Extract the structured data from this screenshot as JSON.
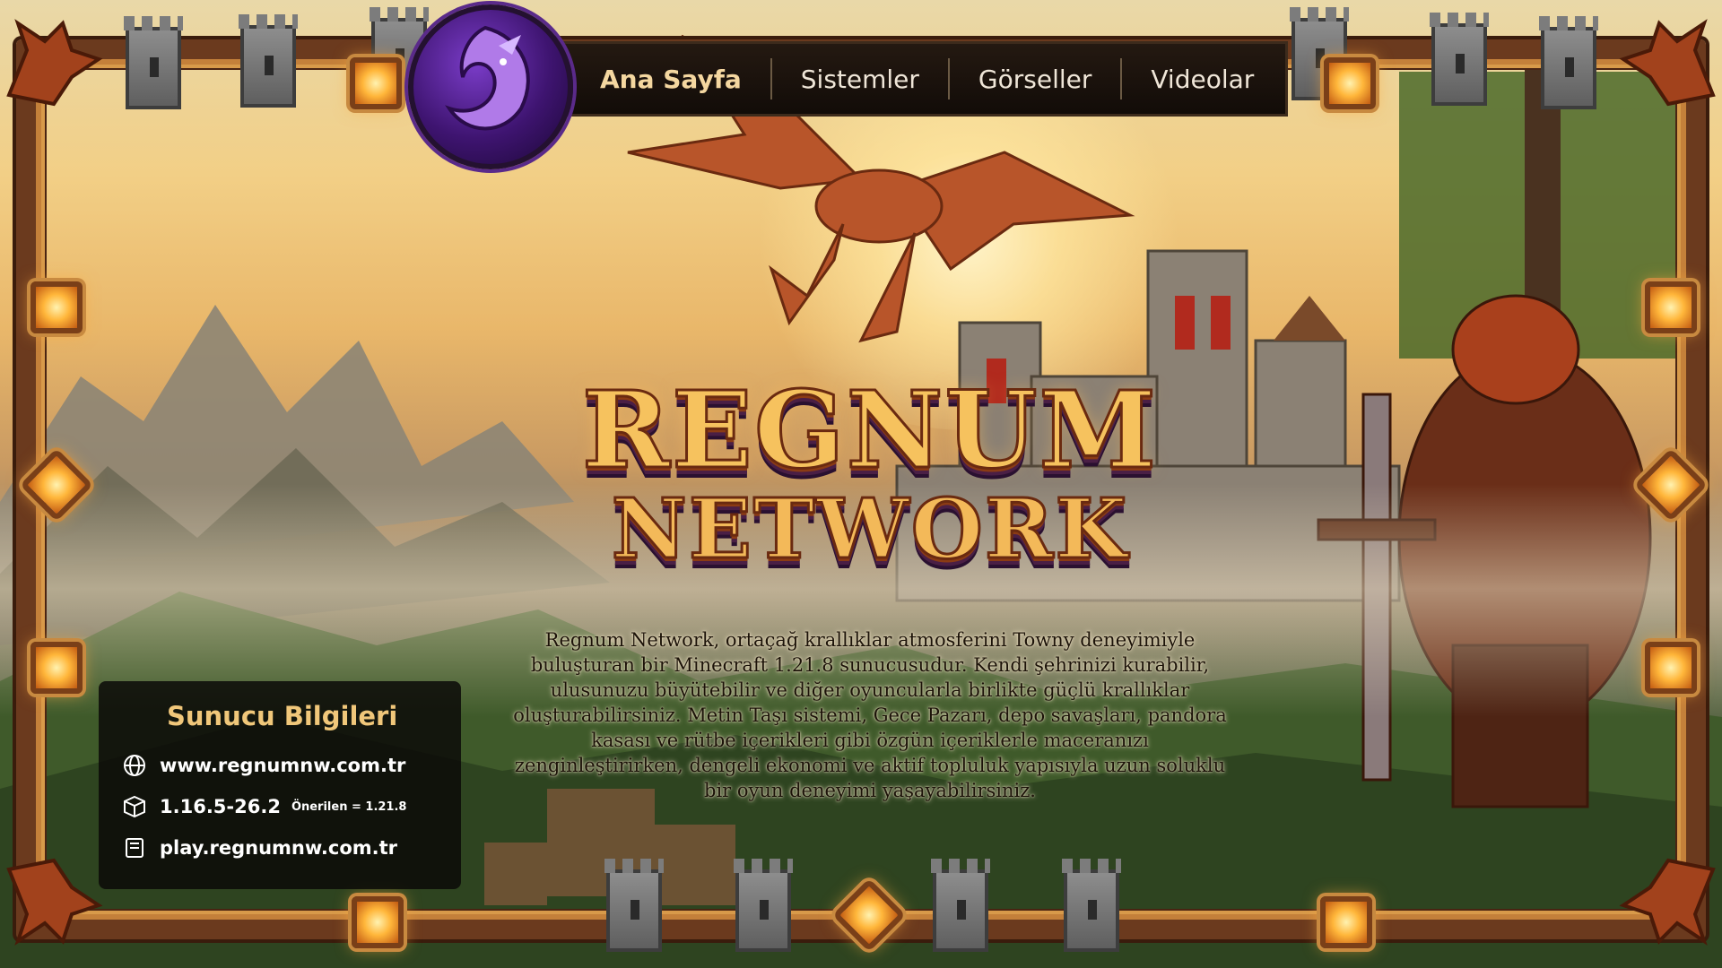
{
  "nav": {
    "items": [
      {
        "label": "Ana Sayfa",
        "active": true
      },
      {
        "label": "Sistemler",
        "active": false
      },
      {
        "label": "Görseller",
        "active": false
      },
      {
        "label": "Videolar",
        "active": false
      }
    ]
  },
  "hero": {
    "title_line1": "REGNUM",
    "title_line2": "NETWORK",
    "description": "Regnum Network, ortaçağ krallıklar atmosferini Towny deneyimiyle buluşturan bir Minecraft 1.21.8 sunucusudur. Kendi şehrinizi kurabilir, ulusunuzu büyütebilir ve diğer oyuncularla birlikte güçlü krallıklar oluşturabilirsiniz. Metin Taşı sistemi, Gece Pazarı, depo savaşları, pandora kasası ve rütbe içerikleri gibi özgün içeriklerle maceranızı zenginleştirirken, dengeli ekonomi ve aktif topluluk yapısıyla uzun soluklu bir oyun deneyimi yaşayabilirsiniz."
  },
  "server_info": {
    "title": "Sunucu Bilgileri",
    "website": "www.regnumnw.com.tr",
    "versions": "1.16.5-26.2",
    "recommended": "Önerilen = 1.21.8",
    "ip": "play.regnumnw.com.tr"
  },
  "icons": {
    "logo": "purple-dragon-logo",
    "website": "globe-icon",
    "version": "cube-icon",
    "ip": "book-icon"
  },
  "colors": {
    "frame": "#6b3a1e",
    "gem": "#ffb63a",
    "title_gold": "#f6c25e",
    "panel_bg": "#0c0a08",
    "panel_title": "#f0c77a"
  }
}
